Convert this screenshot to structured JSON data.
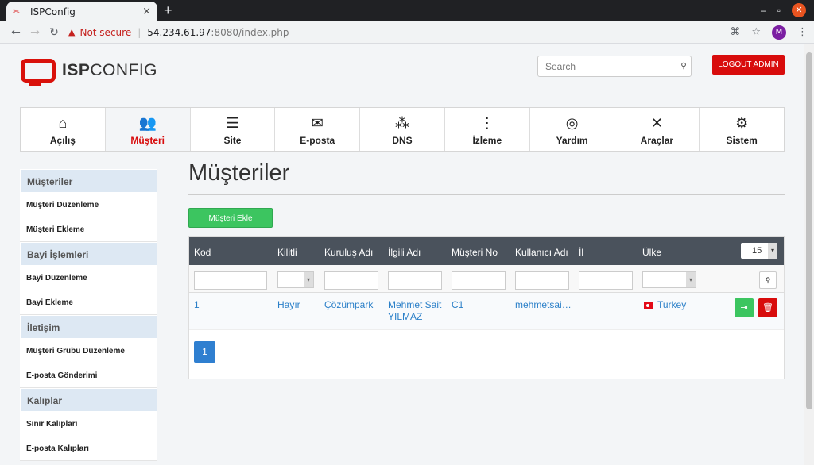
{
  "browser": {
    "tab_title": "ISPConfig",
    "tab_close": "×",
    "new_tab": "+",
    "not_secure": "Not secure",
    "url_host": "54.234.61.97",
    "url_path": ":8080/index.php",
    "avatar_letter": "M"
  },
  "header": {
    "logo_bold": "ISP",
    "logo_rest": "CONFIG",
    "search_placeholder": "Search",
    "logout": "LOGOUT ADMIN"
  },
  "mainnav": [
    {
      "label": "Açılış",
      "icon": "home-icon",
      "glyph": "⌂"
    },
    {
      "label": "Müşteri",
      "icon": "users-icon",
      "glyph": "👥"
    },
    {
      "label": "Site",
      "icon": "list-icon",
      "glyph": "☰"
    },
    {
      "label": "E-posta",
      "icon": "envelope-icon",
      "glyph": "✉"
    },
    {
      "label": "DNS",
      "icon": "sitemap-icon",
      "glyph": "⁂"
    },
    {
      "label": "İzleme",
      "icon": "traffic-light-icon",
      "glyph": "⋮"
    },
    {
      "label": "Yardım",
      "icon": "lifebuoy-icon",
      "glyph": "◎"
    },
    {
      "label": "Araçlar",
      "icon": "tools-icon",
      "glyph": "✕"
    },
    {
      "label": "Sistem",
      "icon": "gear-icon",
      "glyph": "⚙"
    }
  ],
  "active_nav": "Müşteri",
  "sidebar": [
    {
      "type": "head",
      "label": "Müşteriler"
    },
    {
      "type": "item",
      "label": "Müşteri Düzenleme"
    },
    {
      "type": "item",
      "label": "Müşteri Ekleme"
    },
    {
      "type": "head",
      "label": "Bayi İşlemleri"
    },
    {
      "type": "item",
      "label": "Bayi Düzenleme"
    },
    {
      "type": "item",
      "label": "Bayi Ekleme"
    },
    {
      "type": "head",
      "label": "İletişim"
    },
    {
      "type": "item",
      "label": "Müşteri Grubu Düzenleme"
    },
    {
      "type": "item",
      "label": "E-posta Gönderimi"
    },
    {
      "type": "head",
      "label": "Kalıplar"
    },
    {
      "type": "item",
      "label": "Sınır Kalıpları"
    },
    {
      "type": "item",
      "label": "E-posta Kalıpları"
    }
  ],
  "main": {
    "title": "Müşteriler",
    "add_button": "Müşteri Ekle",
    "columns": [
      "Kod",
      "Kilitli",
      "Kuruluş Adı",
      "İlgili Adı",
      "Müşteri No",
      "Kullanıcı Adı",
      "İl",
      "Ülke"
    ],
    "per_page": "15",
    "rows": [
      {
        "kod": "1",
        "kilitli": "Hayır",
        "kurulus": "Çözümpark",
        "ilgili_1": "Mehmet Sait",
        "ilgili_2": "YILMAZ",
        "no": "C1",
        "kullanici": "mehmetsai…",
        "il": "",
        "ulke": "Turkey"
      }
    ],
    "page": "1"
  },
  "colors": {
    "accent": "#d80c0c",
    "add": "#3cc560",
    "table_head": "#4a525c",
    "link": "#2a7fc8"
  }
}
